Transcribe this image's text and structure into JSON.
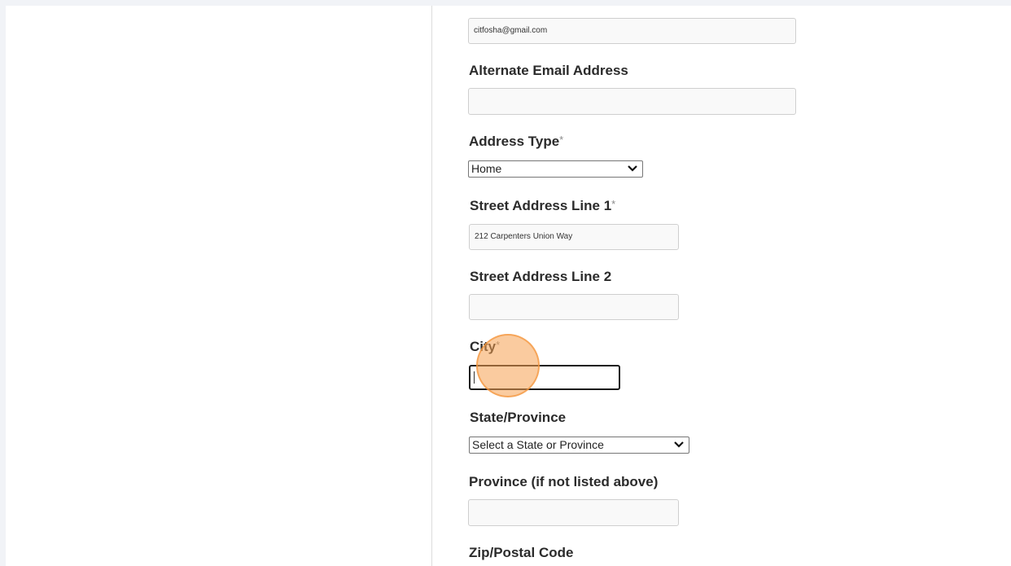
{
  "form": {
    "email": {
      "value": "citfosha@gmail.com"
    },
    "alternate_email": {
      "label": "Alternate Email Address",
      "value": ""
    },
    "address_type": {
      "label": "Address Type",
      "required_mark": "*",
      "selected": "Home"
    },
    "street1": {
      "label": "Street Address Line 1",
      "required_mark": "*",
      "value": "212 Carpenters Union Way"
    },
    "street2": {
      "label": "Street Address Line 2",
      "value": ""
    },
    "city": {
      "label": "City",
      "required_mark": "*",
      "value": ""
    },
    "state": {
      "label": "State/Province",
      "selected": "Select a State or Province"
    },
    "province_other": {
      "label": "Province (if not listed above)",
      "value": ""
    },
    "zip": {
      "label": "Zip/Postal Code"
    }
  },
  "overlay": {
    "click_indicator_color": "#f5a050"
  }
}
